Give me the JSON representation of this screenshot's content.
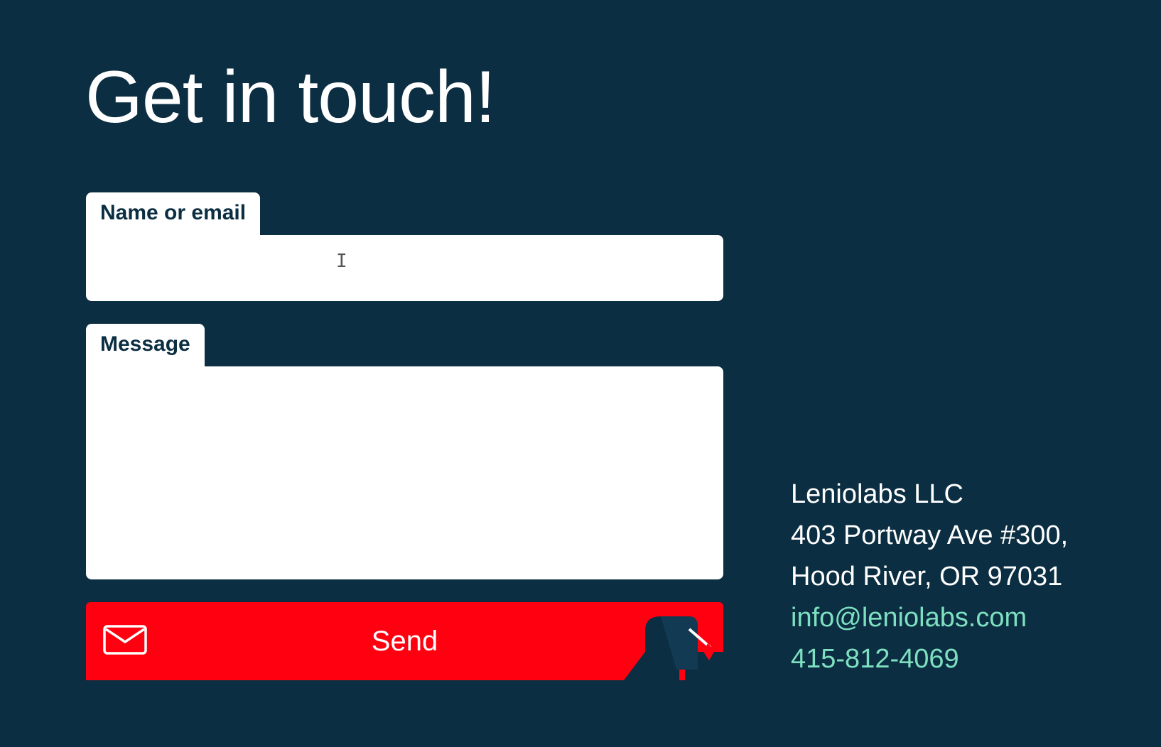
{
  "page": {
    "title": "Get in touch!"
  },
  "form": {
    "name_label": "Name or email",
    "name_value": "",
    "message_label": "Message",
    "message_value": "",
    "send_label": "Send"
  },
  "contact": {
    "company": "Leniolabs LLC",
    "address_line1": "403 Portway Ave #300,",
    "address_line2": "Hood River, OR 97031",
    "email": "info@leniolabs.com",
    "phone": "415-812-4069"
  },
  "colors": {
    "background": "#0b2e42",
    "send_button": "#ff0010",
    "link": "#7ee0c0",
    "text": "#ffffff"
  },
  "icons": {
    "send_icon": "envelope-icon",
    "decoration": "mailbox-icon"
  }
}
